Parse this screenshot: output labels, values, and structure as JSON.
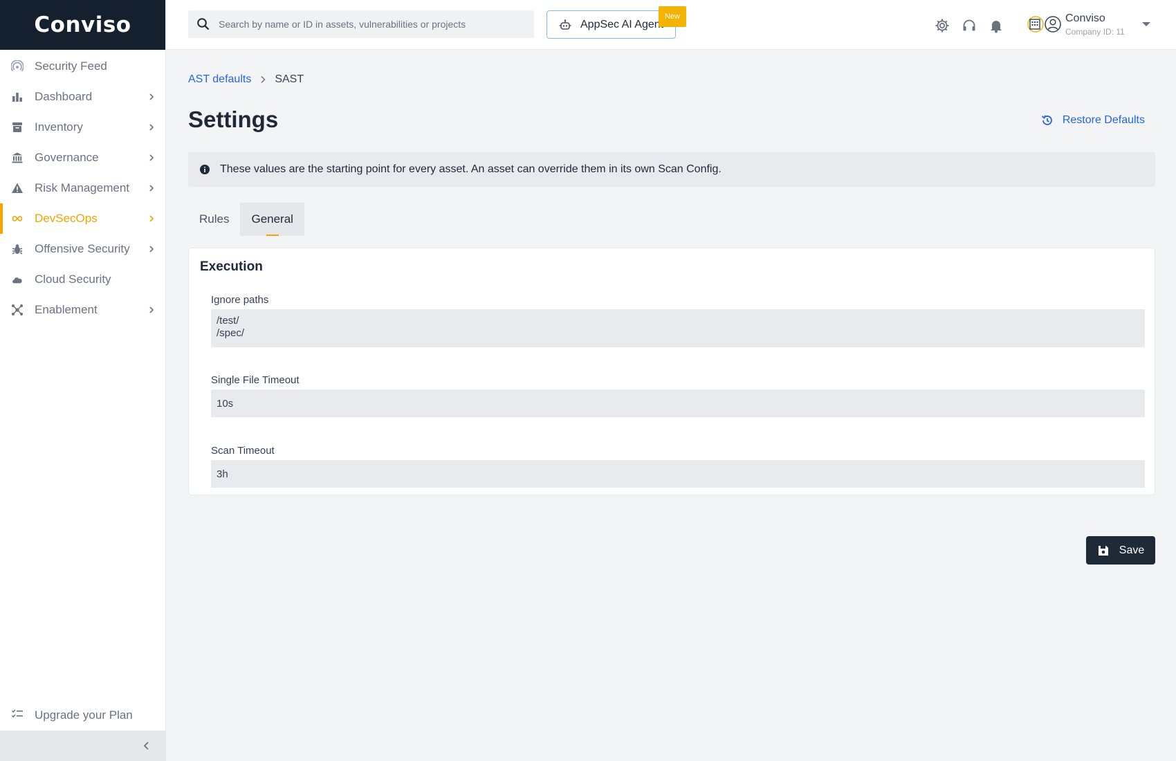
{
  "brand": {
    "name": "Conviso",
    "sidebar_bg": "#15202e",
    "accent": "#f5a400",
    "link": "#2563eb"
  },
  "sidebar": {
    "items": [
      {
        "label": "Security Feed",
        "icon": "rss-icon",
        "has_submenu": false
      },
      {
        "label": "Dashboard",
        "icon": "bar-chart-icon",
        "has_submenu": true
      },
      {
        "label": "Inventory",
        "icon": "archive-icon",
        "has_submenu": true
      },
      {
        "label": "Governance",
        "icon": "bank-icon",
        "has_submenu": true
      },
      {
        "label": "Risk Management",
        "icon": "warning-icon",
        "has_submenu": true
      },
      {
        "label": "DevSecOps",
        "icon": "infinity-icon",
        "has_submenu": true,
        "active": true
      },
      {
        "label": "Offensive Security",
        "icon": "bug-icon",
        "has_submenu": true
      },
      {
        "label": "Cloud Security",
        "icon": "cloud-icon",
        "has_submenu": false
      },
      {
        "label": "Enablement",
        "icon": "hub-icon",
        "has_submenu": true
      }
    ],
    "upgrade_label": "Upgrade your Plan"
  },
  "topbar": {
    "search_placeholder": "Search by name or ID in assets, vulnerabilities or projects",
    "ai_button_label": "AppSec AI Agent",
    "new_badge": "New",
    "company_name": "Conviso",
    "company_id": "Company ID: 11"
  },
  "page": {
    "breadcrumb": {
      "parent": "AST defaults",
      "current": "SAST"
    },
    "title": "Settings",
    "restore_label": "Restore Defaults",
    "info_text": "These values are the starting point for every asset. An asset can override them in its own Scan Config.",
    "tabs": [
      {
        "label": "Rules",
        "active": false
      },
      {
        "label": "General",
        "active": true
      }
    ],
    "section_title": "Execution",
    "fields": {
      "ignore_paths_label": "Ignore paths",
      "ignore_paths_value": "/test/\n/spec/",
      "single_file_timeout_label": "Single File Timeout",
      "single_file_timeout_value": "10s",
      "scan_timeout_label": "Scan Timeout",
      "scan_timeout_value": "3h"
    },
    "save_label": "Save"
  }
}
